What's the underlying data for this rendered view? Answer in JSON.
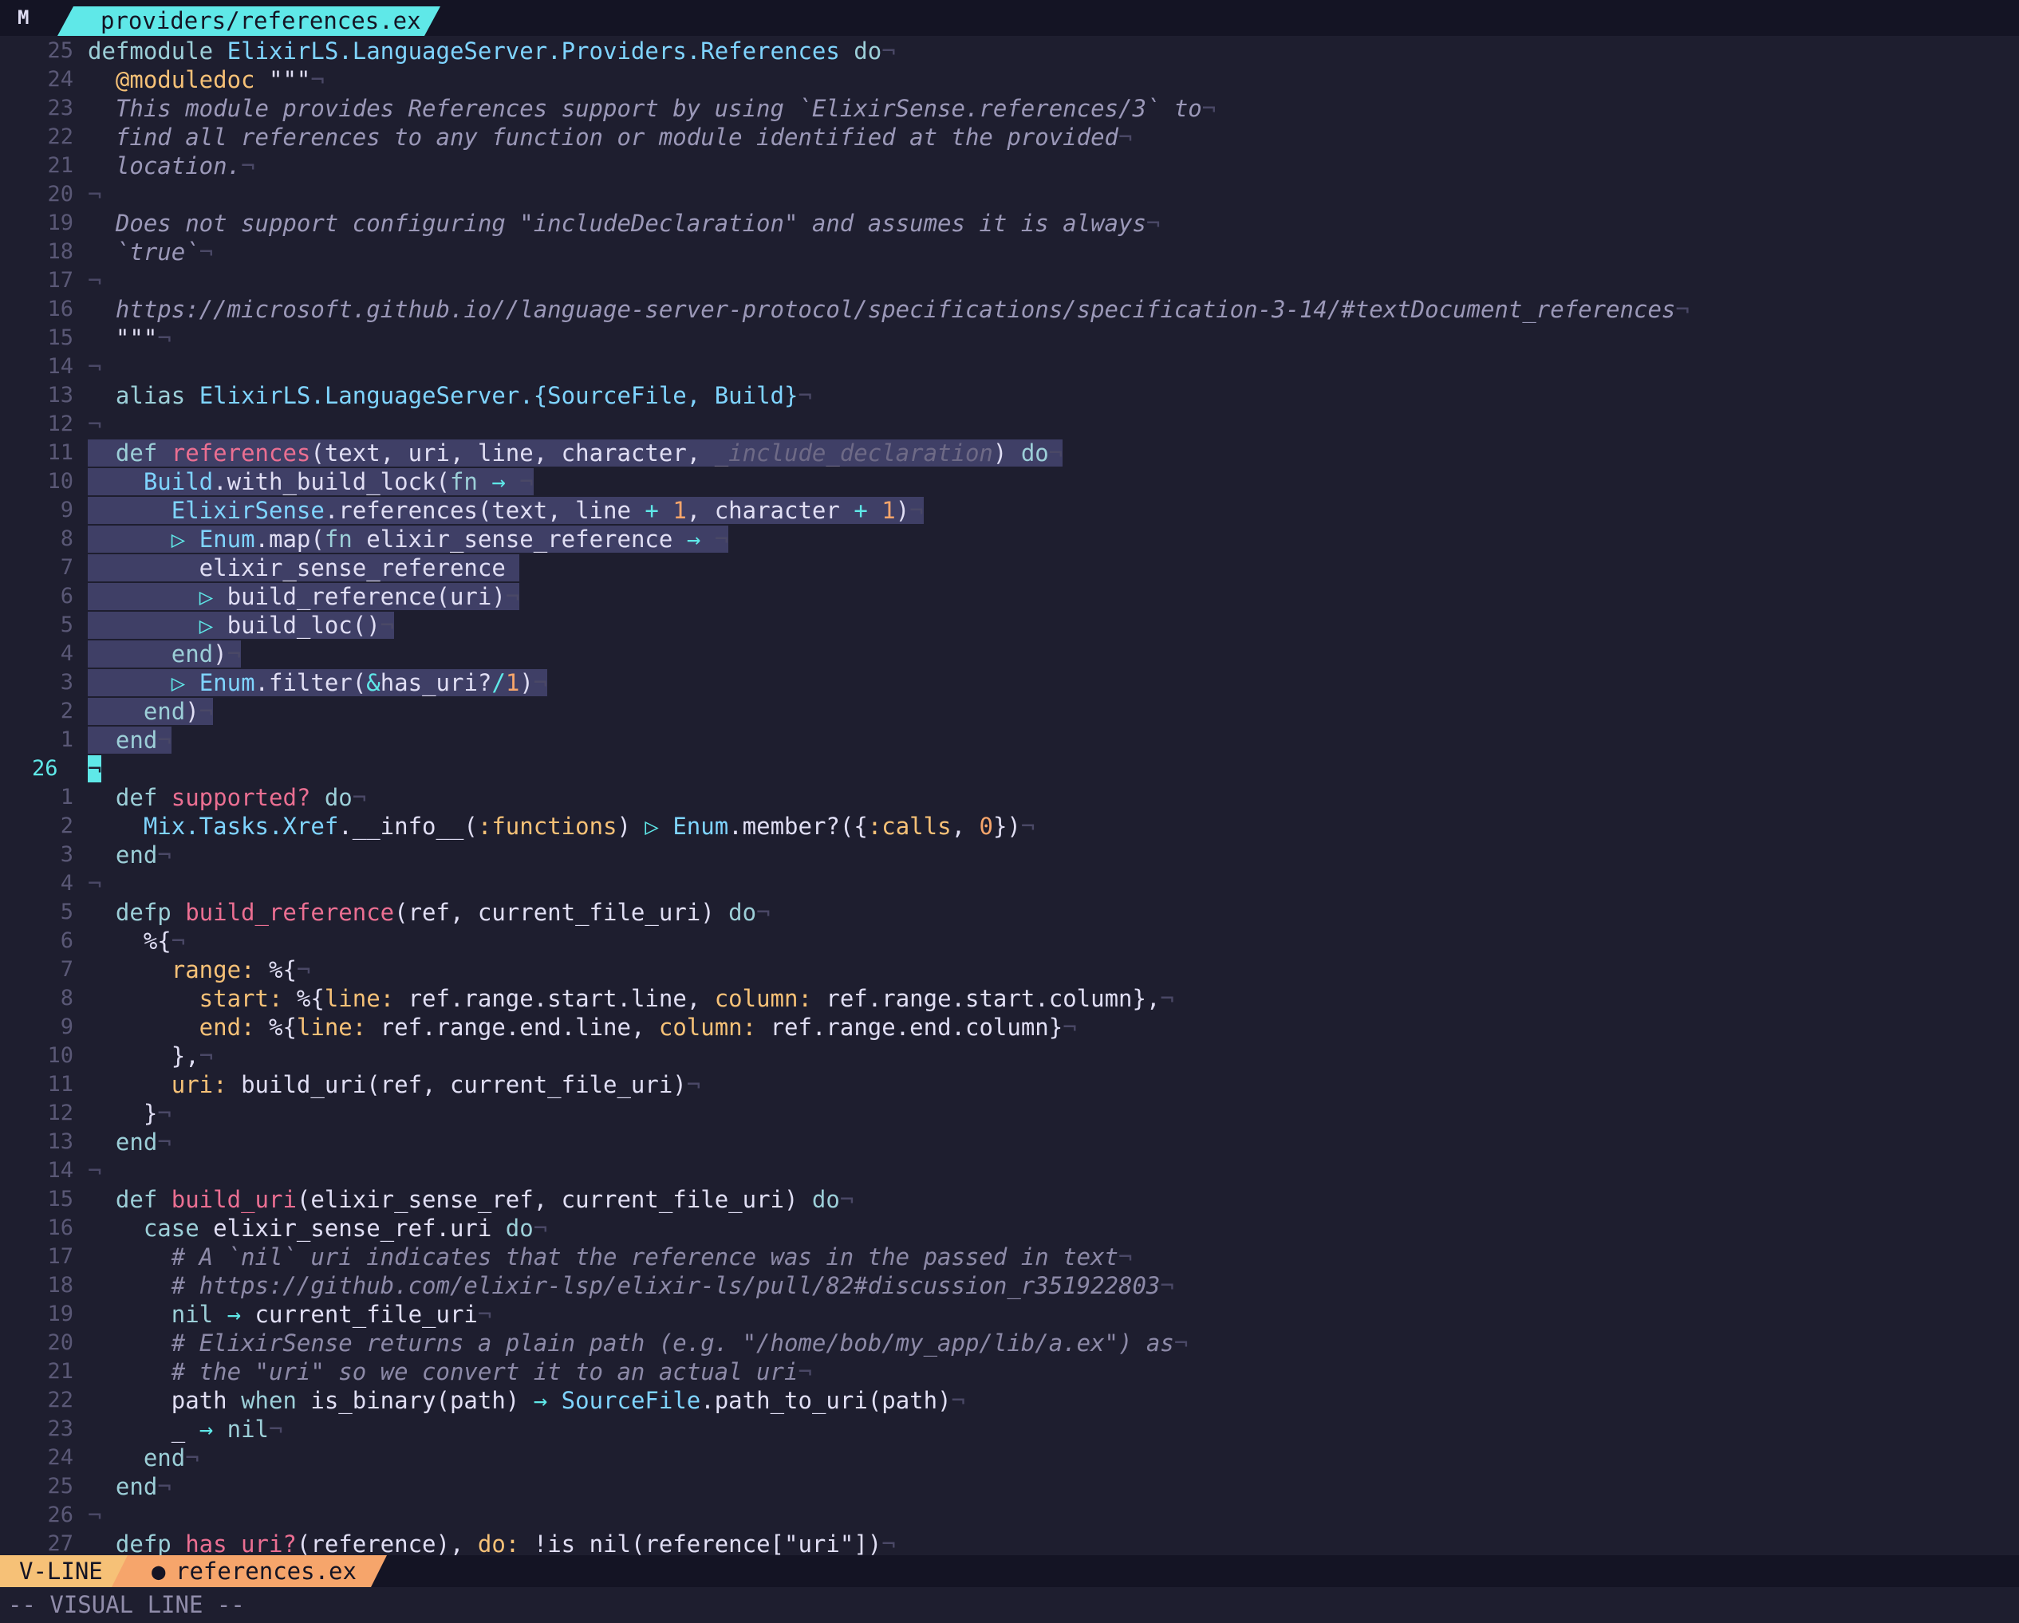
{
  "tab": {
    "title": "providers/references.ex",
    "logo": "M"
  },
  "status": {
    "mode": "V-LINE",
    "file": "references.ex",
    "file_icon": "drop-icon"
  },
  "cmdline": "-- VISUAL LINE --",
  "colors": {
    "cyan": "#5fe8e8",
    "pink": "#eb6f92",
    "gold": "#f6c177",
    "orange": "#f6a56b",
    "bg": "#1e1e2f"
  },
  "lines": [
    {
      "n": "25",
      "segs": [
        [
          "kw",
          "defmodule "
        ],
        [
          "mod",
          "ElixirLS.LanguageServer.Providers.References"
        ],
        [
          "",
          ""
        ],
        [
          "kw",
          " do"
        ],
        [
          "nl",
          "¬"
        ]
      ]
    },
    {
      "n": "24",
      "segs": [
        [
          "",
          "  "
        ],
        [
          "atom",
          "@moduledoc"
        ],
        [
          "",
          " \"\"\""
        ],
        [
          "nl",
          "¬"
        ]
      ]
    },
    {
      "n": "23",
      "segs": [
        [
          "doc",
          "  This module provides References support by using `ElixirSense.references/3` to"
        ],
        [
          "nl",
          "¬"
        ]
      ]
    },
    {
      "n": "22",
      "segs": [
        [
          "doc",
          "  find all references to any function or module identified at the provided"
        ],
        [
          "nl",
          "¬"
        ]
      ]
    },
    {
      "n": "21",
      "segs": [
        [
          "doc",
          "  location."
        ],
        [
          "nl",
          "¬"
        ]
      ]
    },
    {
      "n": "20",
      "segs": [
        [
          "nl",
          "¬"
        ]
      ]
    },
    {
      "n": "19",
      "segs": [
        [
          "doc",
          "  Does not support configuring \"includeDeclaration\" and assumes it is always"
        ],
        [
          "nl",
          "¬"
        ]
      ]
    },
    {
      "n": "18",
      "segs": [
        [
          "doc",
          "  `true`"
        ],
        [
          "nl",
          "¬"
        ]
      ]
    },
    {
      "n": "17",
      "segs": [
        [
          "nl",
          "¬"
        ]
      ]
    },
    {
      "n": "16",
      "segs": [
        [
          "doc",
          "  https://microsoft.github.io//language-server-protocol/specifications/specification-3-14/#textDocument_references"
        ],
        [
          "nl",
          "¬"
        ]
      ]
    },
    {
      "n": "15",
      "segs": [
        [
          "",
          "  \"\"\""
        ],
        [
          "nl",
          "¬"
        ]
      ]
    },
    {
      "n": "14",
      "segs": [
        [
          "nl",
          "¬"
        ]
      ]
    },
    {
      "n": "13",
      "segs": [
        [
          "kw",
          "  alias "
        ],
        [
          "mod",
          "ElixirLS.LanguageServer.{SourceFile, Build}"
        ],
        [
          "nl",
          "¬"
        ]
      ]
    },
    {
      "n": "12",
      "segs": [
        [
          "nl",
          "¬"
        ]
      ]
    },
    {
      "n": "11",
      "sel": true,
      "segs": [
        [
          "kw",
          "  def "
        ],
        [
          "fn",
          "references"
        ],
        [
          "",
          "(text, uri, line, character, "
        ],
        [
          "dim",
          "_include_declaration"
        ],
        [
          "",
          ") "
        ],
        [
          "kw",
          "do"
        ],
        [
          "nl",
          "¬"
        ]
      ]
    },
    {
      "n": "10",
      "sel": true,
      "segs": [
        [
          "",
          "    "
        ],
        [
          "mod",
          "Build"
        ],
        [
          "",
          ".with_build_lock("
        ],
        [
          "kw",
          "fn "
        ],
        [
          "op",
          "→"
        ],
        [
          "nl",
          " ¬"
        ]
      ]
    },
    {
      "n": "9",
      "sel": true,
      "segs": [
        [
          "",
          "      "
        ],
        [
          "mod",
          "ElixirSense"
        ],
        [
          "",
          ".references(text, line "
        ],
        [
          "op",
          "+"
        ],
        [
          "num",
          " 1"
        ],
        [
          "",
          ", character "
        ],
        [
          "op",
          "+"
        ],
        [
          "num",
          " 1"
        ],
        [
          "",
          ")"
        ],
        [
          "nl",
          "¬"
        ]
      ]
    },
    {
      "n": "8",
      "sel": true,
      "segs": [
        [
          "",
          "      "
        ],
        [
          "pipe",
          "▷ "
        ],
        [
          "mod",
          "Enum"
        ],
        [
          "",
          ".map("
        ],
        [
          "kw",
          "fn "
        ],
        [
          "",
          "elixir_sense_reference "
        ],
        [
          "op",
          "→"
        ],
        [
          "nl",
          " ¬"
        ]
      ]
    },
    {
      "n": "7",
      "sel": true,
      "segs": [
        [
          "",
          "        elixir_sense_reference"
        ],
        [
          "nl",
          " "
        ]
      ]
    },
    {
      "n": "6",
      "sel": true,
      "segs": [
        [
          "",
          "        "
        ],
        [
          "pipe",
          "▷ "
        ],
        [
          "",
          "build_reference(uri)"
        ],
        [
          "nl",
          "¬"
        ]
      ]
    },
    {
      "n": "5",
      "sel": true,
      "segs": [
        [
          "",
          "        "
        ],
        [
          "pipe",
          "▷ "
        ],
        [
          "",
          "build_loc()"
        ],
        [
          "nl",
          "¬"
        ]
      ]
    },
    {
      "n": "4",
      "sel": true,
      "segs": [
        [
          "kw",
          "      end"
        ],
        [
          "",
          ")"
        ],
        [
          "nl",
          "¬"
        ]
      ]
    },
    {
      "n": "3",
      "sel": true,
      "segs": [
        [
          "",
          "      "
        ],
        [
          "pipe",
          "▷ "
        ],
        [
          "mod",
          "Enum"
        ],
        [
          "",
          ".filter("
        ],
        [
          "op",
          "&"
        ],
        [
          "",
          "has_uri?"
        ],
        [
          "op",
          "/"
        ],
        [
          "num",
          "1"
        ],
        [
          "",
          ")"
        ],
        [
          "nl",
          "¬"
        ]
      ]
    },
    {
      "n": "2",
      "sel": true,
      "segs": [
        [
          "kw",
          "    end"
        ],
        [
          "",
          ")"
        ],
        [
          "nl",
          "¬"
        ]
      ]
    },
    {
      "n": "1",
      "sel": true,
      "segs": [
        [
          "kw",
          "  end"
        ],
        [
          "nl",
          "¬"
        ]
      ]
    },
    {
      "n": "26",
      "cur": true,
      "segs": [
        [
          "cursor",
          "¬"
        ]
      ]
    },
    {
      "n": "1",
      "segs": [
        [
          "kw",
          "  def "
        ],
        [
          "fn",
          "supported?"
        ],
        [
          "kw",
          " do"
        ],
        [
          "nl",
          "¬"
        ]
      ]
    },
    {
      "n": "2",
      "segs": [
        [
          "",
          "    "
        ],
        [
          "mod",
          "Mix.Tasks.Xref"
        ],
        [
          "",
          ".__info__("
        ],
        [
          "atom",
          ":functions"
        ],
        [
          "",
          ") "
        ],
        [
          "pipe",
          "▷ "
        ],
        [
          "mod",
          "Enum"
        ],
        [
          "",
          ".member?({"
        ],
        [
          "atom",
          ":calls"
        ],
        [
          "",
          ", "
        ],
        [
          "num",
          "0"
        ],
        [
          "",
          "})"
        ],
        [
          "nl",
          "¬"
        ]
      ]
    },
    {
      "n": "3",
      "segs": [
        [
          "kw",
          "  end"
        ],
        [
          "nl",
          "¬"
        ]
      ]
    },
    {
      "n": "4",
      "segs": [
        [
          "nl",
          "¬"
        ]
      ]
    },
    {
      "n": "5",
      "segs": [
        [
          "kw",
          "  defp "
        ],
        [
          "fn",
          "build_reference"
        ],
        [
          "",
          "(ref, current_file_uri) "
        ],
        [
          "kw",
          "do"
        ],
        [
          "nl",
          "¬"
        ]
      ]
    },
    {
      "n": "6",
      "segs": [
        [
          "",
          "    %{"
        ],
        [
          "nl",
          "¬"
        ]
      ]
    },
    {
      "n": "7",
      "segs": [
        [
          "atom",
          "      range: "
        ],
        [
          "",
          "%{"
        ],
        [
          "nl",
          "¬"
        ]
      ]
    },
    {
      "n": "8",
      "segs": [
        [
          "atom",
          "        start: "
        ],
        [
          "",
          "%{"
        ],
        [
          "atom",
          "line: "
        ],
        [
          "",
          "ref.range.start.line, "
        ],
        [
          "atom",
          "column: "
        ],
        [
          "",
          "ref.range.start.column},"
        ],
        [
          "nl",
          "¬"
        ]
      ]
    },
    {
      "n": "9",
      "segs": [
        [
          "atom",
          "        end: "
        ],
        [
          "",
          "%{"
        ],
        [
          "atom",
          "line: "
        ],
        [
          "",
          "ref.range.end.line, "
        ],
        [
          "atom",
          "column: "
        ],
        [
          "",
          "ref.range.end.column}"
        ],
        [
          "nl",
          "¬"
        ]
      ]
    },
    {
      "n": "10",
      "segs": [
        [
          "",
          "      },"
        ],
        [
          "nl",
          "¬"
        ]
      ]
    },
    {
      "n": "11",
      "segs": [
        [
          "atom",
          "      uri: "
        ],
        [
          "",
          "build_uri(ref, current_file_uri)"
        ],
        [
          "nl",
          "¬"
        ]
      ]
    },
    {
      "n": "12",
      "segs": [
        [
          "",
          "    }"
        ],
        [
          "nl",
          "¬"
        ]
      ]
    },
    {
      "n": "13",
      "segs": [
        [
          "kw",
          "  end"
        ],
        [
          "nl",
          "¬"
        ]
      ]
    },
    {
      "n": "14",
      "segs": [
        [
          "nl",
          "¬"
        ]
      ]
    },
    {
      "n": "15",
      "segs": [
        [
          "kw",
          "  def "
        ],
        [
          "fn",
          "build_uri"
        ],
        [
          "",
          "(elixir_sense_ref, current_file_uri) "
        ],
        [
          "kw",
          "do"
        ],
        [
          "nl",
          "¬"
        ]
      ]
    },
    {
      "n": "16",
      "segs": [
        [
          "kw",
          "    case "
        ],
        [
          "",
          "elixir_sense_ref.uri "
        ],
        [
          "kw",
          "do"
        ],
        [
          "nl",
          "¬"
        ]
      ]
    },
    {
      "n": "17",
      "segs": [
        [
          "cm",
          "      # A `nil` uri indicates that the reference was in the passed in text"
        ],
        [
          "nl",
          "¬"
        ]
      ]
    },
    {
      "n": "18",
      "segs": [
        [
          "cm",
          "      # https://github.com/elixir-lsp/elixir-ls/pull/82#discussion_r351922803"
        ],
        [
          "nl",
          "¬"
        ]
      ]
    },
    {
      "n": "19",
      "segs": [
        [
          "kw",
          "      nil "
        ],
        [
          "op",
          "→ "
        ],
        [
          "",
          "current_file_uri"
        ],
        [
          "nl",
          "¬"
        ]
      ]
    },
    {
      "n": "20",
      "segs": [
        [
          "cm",
          "      # ElixirSense returns a plain path (e.g. \"/home/bob/my_app/lib/a.ex\") as"
        ],
        [
          "nl",
          "¬"
        ]
      ]
    },
    {
      "n": "21",
      "segs": [
        [
          "cm",
          "      # the \"uri\" so we convert it to an actual uri"
        ],
        [
          "nl",
          "¬"
        ]
      ]
    },
    {
      "n": "22",
      "segs": [
        [
          "",
          "      path "
        ],
        [
          "kw",
          "when "
        ],
        [
          "",
          "is_binary(path) "
        ],
        [
          "op",
          "→ "
        ],
        [
          "mod",
          "SourceFile"
        ],
        [
          "",
          ".path_to_uri(path)"
        ],
        [
          "nl",
          "¬"
        ]
      ]
    },
    {
      "n": "23",
      "segs": [
        [
          "",
          "      _ "
        ],
        [
          "op",
          "→ "
        ],
        [
          "kw",
          "nil"
        ],
        [
          "nl",
          "¬"
        ]
      ]
    },
    {
      "n": "24",
      "segs": [
        [
          "kw",
          "    end"
        ],
        [
          "nl",
          "¬"
        ]
      ]
    },
    {
      "n": "25",
      "segs": [
        [
          "kw",
          "  end"
        ],
        [
          "nl",
          "¬"
        ]
      ]
    },
    {
      "n": "26",
      "segs": [
        [
          "nl",
          "¬"
        ]
      ]
    },
    {
      "n": "27",
      "segs": [
        [
          "kw",
          "  defp "
        ],
        [
          "fn",
          "has_uri?"
        ],
        [
          "",
          "(reference), "
        ],
        [
          "atom",
          "do: "
        ],
        [
          "",
          "!is_nil(reference["
        ],
        [
          "str",
          "\"uri\""
        ],
        [
          "",
          "])"
        ],
        [
          "nl",
          "¬"
        ]
      ]
    }
  ]
}
